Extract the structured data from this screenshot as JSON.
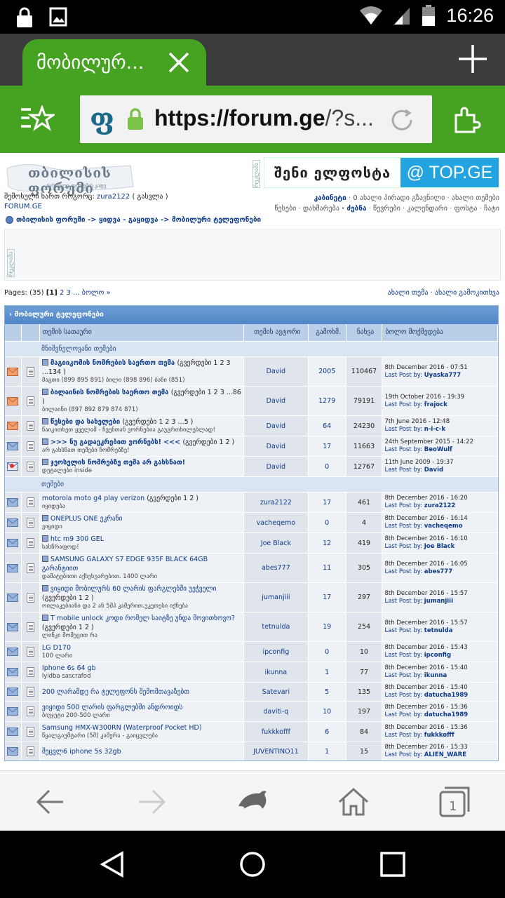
{
  "status": {
    "time": "16:26"
  },
  "tab": {
    "title": "მობილურ..."
  },
  "address": {
    "scheme_host_bold": "https://forum.ge",
    "rest": "/?s..."
  },
  "site": {
    "logo": "თბილისის ფორუმი",
    "logo_sub": "ქართული ფორუმის კაფე",
    "ad_label": "რეკლამა",
    "banner_slogan": "შენი ელფოსტა",
    "banner_brand": "@ TOP.GE",
    "user_prefix": "შემოსული ხართ როგორც:",
    "username": "zura2122",
    "logout": "( გასვლა )",
    "forumge": "FORUM.GE",
    "rightlinks_line1": [
      "კაბინეტი",
      "· 0 ახალი პირადი გზავნილი",
      "· ახალი თემები"
    ],
    "rightlinks_line2": [
      "წესები",
      "· დახმარება",
      "· ძებნა",
      "· წევრები",
      "· კალენდარი",
      "· ფოსტა",
      "· ჩატი"
    ],
    "breadcrumb": "თბილისის ფორუმი -> ყიდვა - გაყიდვა -> მობილური ტელეფონები",
    "pages_prefix": "Pages: (35)",
    "pages_current": "[1]",
    "pages_rest": "2 3 ... ბოლო »",
    "new_links": "ახალი თემა · ახალი გამოკითხვა"
  },
  "forum": {
    "title": "› მობილური ტელეფონები",
    "headers": {
      "title": "თემის სათაური",
      "author": "თემის ავტორი",
      "replies": "გამოხმ.",
      "views": "ნახვა",
      "last": "ბოლო მოქმედება"
    },
    "section_pinned": "მნიშვნელოვანი თემები",
    "section_topics": "თემები",
    "pinned": [
      {
        "title": "მაგიიკომის ნომრების საერთო თემა",
        "pages": "(გვერდები 1 2 3 ...134 )",
        "sub": "მაგთი (899 895 891) ბილი (898 896) ბანი (851)",
        "author": "David",
        "replies": "2005",
        "views": "110467",
        "date": "8th December 2016 - 07:51",
        "lastby": "Uyaska777",
        "icon": "hot"
      },
      {
        "title": "ბილაინის ნომრების საერთო თემა",
        "pages": "(გვერდები 1 2 3 ...86 )",
        "sub": "ბილაინი (897 892 879 874 871)",
        "author": "David",
        "replies": "1279",
        "views": "79191",
        "date": "19th October 2016 - 19:39",
        "lastby": "frajock",
        "icon": "hot"
      },
      {
        "title": "წესები და სახელები",
        "pages": "(გვერდები 1 2 3 ...5 )",
        "sub": "წაიკითხეთ ყველამ - ჩვენთან ვორნებია გაუგრთხილებლად!",
        "author": "David",
        "replies": "64",
        "views": "24230",
        "date": "7th June 2016 - 12:48",
        "lastby": "n-i-c-k",
        "icon": "hot"
      },
      {
        "title": ">>> ნუ გადაეკრებით ვორნებს! <<<",
        "pages": "(გვერდები 1 2 )",
        "sub": "არ გახსნათ თემები ნომრებზე!",
        "author": "David",
        "replies": "17",
        "views": "11663",
        "date": "24th September 2015 - 14:22",
        "lastby": "BeoWulf",
        "icon": "normal"
      },
      {
        "title": "ჯეოსელის ნომრებზე თემა არ გახსნათ!",
        "pages": "",
        "sub": "დეტალები inside",
        "author": "David",
        "replies": "0",
        "views": "12767",
        "date": "11th June 2009 - 19:37",
        "lastby": "David",
        "icon": "locked"
      }
    ],
    "topics": [
      {
        "title": "motorola moto g4 play verizon",
        "pages": "(გვერდები 1 2 )",
        "sub": "იყიდება",
        "author": "zura2122",
        "replies": "17",
        "views": "461",
        "date": "8th December 2016 - 16:20",
        "lastby": "zura2122",
        "mini": false
      },
      {
        "title": "ONEPLUS ONE ეკრანი",
        "pages": "",
        "sub": "ვიყიდი",
        "author": "vacheqemo",
        "replies": "0",
        "views": "4",
        "date": "8th December 2016 - 16:14",
        "lastby": "vacheqemo",
        "mini": true
      },
      {
        "title": "htc m9 300 GEL",
        "pages": "",
        "sub": "სასწრაფოდ!",
        "author": "Joe Black",
        "replies": "12",
        "views": "419",
        "date": "8th December 2016 - 16:10",
        "lastby": "Joe Black",
        "mini": true
      },
      {
        "title": "SAMSUNG GALAXY S7 EDGE 935F BLACK 64GB გარანტიით",
        "pages": "",
        "sub": "დამატებითი აქსესუარებით. 1400 ლარი",
        "author": "abes777",
        "replies": "11",
        "views": "305",
        "date": "8th December 2016 - 16:05",
        "lastby": "abes777",
        "mini": true
      },
      {
        "title": "ვიყიდი მობილურს 60 ლარის ფარგლებში უეჭველი",
        "pages": "(გვერდები 1 2 )",
        "sub": "ოილაკებიანი და 2 ან 5მპ კამერით.უკეთესი იქნება",
        "author": "jumanjiii",
        "replies": "17",
        "views": "297",
        "date": "8th December 2016 - 15:57",
        "lastby": "jumanjiii",
        "mini": true
      },
      {
        "title": "T mobile unlock კოდი რომელ საიტზე უნდა მოვითხოვო?",
        "pages": "(გვერდები 1 2 )",
        "sub": "ლინკი მომეცით რა",
        "author": "tetnulda",
        "replies": "19",
        "views": "254",
        "date": "8th December 2016 - 15:57",
        "lastby": "tetnulda",
        "mini": true
      },
      {
        "title": "LG D170",
        "pages": "",
        "sub": "100 ლარი",
        "author": "ipconfig",
        "replies": "0",
        "views": "10",
        "date": "8th December 2016 - 15:43",
        "lastby": "ipconfig",
        "mini": false
      },
      {
        "title": "Iphone 6s 64 gb",
        "pages": "",
        "sub": "lyidba sascrafod",
        "author": "ikunna",
        "replies": "1",
        "views": "77",
        "date": "8th December 2016 - 15:40",
        "lastby": "ikunna",
        "mini": false
      },
      {
        "title": "200 ლარამდე რა ტელეფონს შემომთავაზებთ",
        "pages": "",
        "sub": "",
        "author": "Satevari",
        "replies": "5",
        "views": "135",
        "date": "8th December 2016 - 15:40",
        "lastby": "datucha1989",
        "mini": false
      },
      {
        "title": "ვიყიდი 500 ლარის ფარგლებში ანდროიდს",
        "pages": "",
        "sub": "ბიუჯეტი 200-500 ლარი",
        "author": "daviti-q",
        "replies": "10",
        "views": "197",
        "date": "8th December 2016 - 15:36",
        "lastby": "datucha1989",
        "mini": false
      },
      {
        "title": "Samsung HMX-W300RN (Waterproof Pocket HD)",
        "pages": "",
        "sub": "წყალგაუმტარი (5მ) კამერა - გაიცვლება",
        "author": "fukkkofff",
        "replies": "6",
        "views": "84",
        "date": "8th December 2016 - 15:36",
        "lastby": "fukkkofff",
        "mini": false
      },
      {
        "title": "შეცვლ6 iphone 5s 32gb",
        "pages": "",
        "sub": "",
        "author": "JUVENTINO11",
        "replies": "1",
        "views": "15",
        "date": "8th December 2016 - 15:33",
        "lastby": "ALIEN_WARE",
        "mini": false
      }
    ],
    "last_post_label": "Last Post by:"
  },
  "colors": {
    "accent": "#46a322",
    "tabbar": "#3b3b3b",
    "link": "#0b3a8a",
    "table_head": "#b9cfe8"
  }
}
